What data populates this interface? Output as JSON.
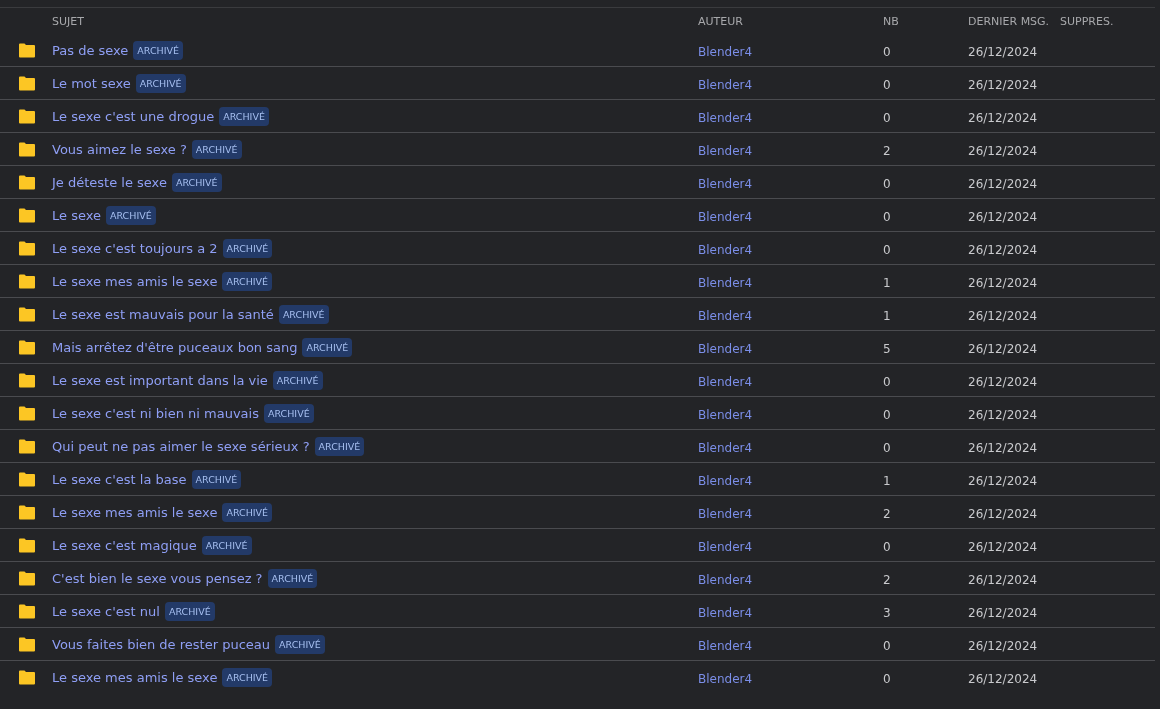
{
  "table": {
    "columns": [
      "SUJET",
      "AUTEUR",
      "NB",
      "DERNIER MSG.",
      "SUPPRES."
    ],
    "rows": [
      {
        "title": "Pas de sexe",
        "badge": "ARCHIVÉ",
        "author": "Blender4",
        "count": "0",
        "date": "26/12/2024"
      },
      {
        "title": "Le mot sexe",
        "badge": "ARCHIVÉ",
        "author": "Blender4",
        "count": "0",
        "date": "26/12/2024"
      },
      {
        "title": "Le sexe c'est une drogue",
        "badge": "ARCHIVÉ",
        "author": "Blender4",
        "count": "0",
        "date": "26/12/2024"
      },
      {
        "title": "Vous aimez le sexe ?",
        "badge": "ARCHIVÉ",
        "author": "Blender4",
        "count": "2",
        "date": "26/12/2024"
      },
      {
        "title": "Je déteste le sexe",
        "badge": "ARCHIVÉ",
        "author": "Blender4",
        "count": "0",
        "date": "26/12/2024"
      },
      {
        "title": "Le sexe",
        "badge": "ARCHIVÉ",
        "author": "Blender4",
        "count": "0",
        "date": "26/12/2024"
      },
      {
        "title": "Le sexe c'est toujours a 2",
        "badge": "ARCHIVÉ",
        "author": "Blender4",
        "count": "0",
        "date": "26/12/2024"
      },
      {
        "title": "Le sexe mes amis le sexe",
        "badge": "ARCHIVÉ",
        "author": "Blender4",
        "count": "1",
        "date": "26/12/2024"
      },
      {
        "title": "Le sexe est mauvais pour la santé",
        "badge": "ARCHIVÉ",
        "author": "Blender4",
        "count": "1",
        "date": "26/12/2024"
      },
      {
        "title": "Mais arrêtez d'être puceaux bon sang",
        "badge": "ARCHIVÉ",
        "author": "Blender4",
        "count": "5",
        "date": "26/12/2024"
      },
      {
        "title": "Le sexe est important dans la vie",
        "badge": "ARCHIVÉ",
        "author": "Blender4",
        "count": "0",
        "date": "26/12/2024"
      },
      {
        "title": "Le sexe c'est ni bien ni mauvais",
        "badge": "ARCHIVÉ",
        "author": "Blender4",
        "count": "0",
        "date": "26/12/2024"
      },
      {
        "title": "Qui peut ne pas aimer le sexe sérieux ?",
        "badge": "ARCHIVÉ",
        "author": "Blender4",
        "count": "0",
        "date": "26/12/2024"
      },
      {
        "title": "Le sexe c'est la base",
        "badge": "ARCHIVÉ",
        "author": "Blender4",
        "count": "1",
        "date": "26/12/2024"
      },
      {
        "title": "Le sexe mes amis le sexe",
        "badge": "ARCHIVÉ",
        "author": "Blender4",
        "count": "2",
        "date": "26/12/2024"
      },
      {
        "title": "Le sexe c'est magique",
        "badge": "ARCHIVÉ",
        "author": "Blender4",
        "count": "0",
        "date": "26/12/2024"
      },
      {
        "title": "C'est bien le sexe vous pensez ?",
        "badge": "ARCHIVÉ",
        "author": "Blender4",
        "count": "2",
        "date": "26/12/2024"
      },
      {
        "title": "Le sexe c'est nul",
        "badge": "ARCHIVÉ",
        "author": "Blender4",
        "count": "3",
        "date": "26/12/2024"
      },
      {
        "title": "Vous faites bien de rester puceau",
        "badge": "ARCHIVÉ",
        "author": "Blender4",
        "count": "0",
        "date": "26/12/2024"
      },
      {
        "title": "Le sexe mes amis le sexe",
        "badge": "ARCHIVÉ",
        "author": "Blender4",
        "count": "0",
        "date": "26/12/2024"
      }
    ]
  }
}
